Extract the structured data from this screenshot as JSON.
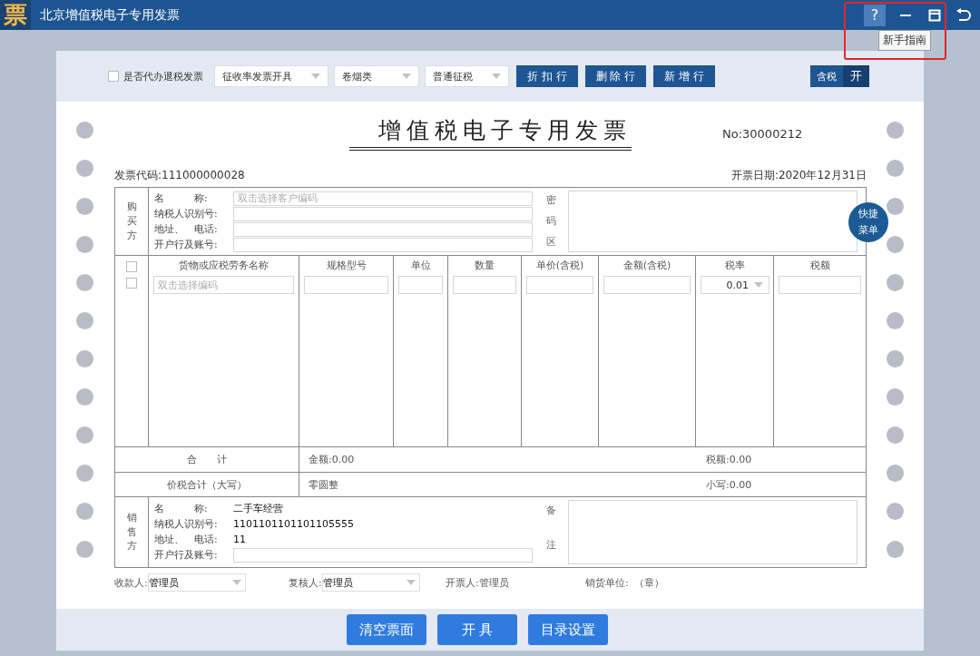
{
  "window": {
    "logo": "票",
    "title": "北京增值税电子专用发票",
    "help": "?",
    "tooltip": "新手指南"
  },
  "toolbar": {
    "checkbox": {
      "label": "是否代办退税发票",
      "checked": false
    },
    "dropdowns": [
      {
        "value": "征收率发票开具"
      },
      {
        "value": "卷烟类"
      },
      {
        "value": "普通征税"
      }
    ],
    "buttons": [
      "折 扣 行",
      "删 除 行",
      "新 增 行"
    ],
    "tax_toggle": {
      "label": "含税",
      "value": "开",
      "on": true
    }
  },
  "invoice": {
    "title": "增值税电子专用发票",
    "number": "No:30000212",
    "code": "发票代码:111000000028",
    "date": "开票日期:2020年12月31日",
    "buyer": {
      "side_label": "购买方",
      "fields": [
        {
          "label": "名　　　称:",
          "placeholder": "双击选择客户编码"
        },
        {
          "label": "纳税人识别号:"
        },
        {
          "label": "地址、　电话:"
        },
        {
          "label": "开户行及账号:"
        }
      ],
      "cipher_label": "密码区"
    },
    "quick_menu": "快捷菜单",
    "items": {
      "select_checkboxes": [
        {
          "checked": false
        },
        {
          "checked": false
        }
      ],
      "columns": [
        "货物或应税劳务名称",
        "规格型号",
        "单位",
        "数量",
        "单价(含税)",
        "金额(含税)",
        "税率",
        "税额"
      ],
      "name_placeholder": "双击选择编码",
      "tax_rate": "0.01"
    },
    "total": {
      "label": "合　　计",
      "amount": "金额:0.00",
      "tax": "税额:0.00"
    },
    "grand_total": {
      "label": "价税合计（大写）",
      "words": "零圆整",
      "figures": "小写:0.00"
    },
    "seller": {
      "side_label": "销售方",
      "fields": [
        {
          "label": "名　　　称:",
          "kind": "text",
          "value": "二手车经营"
        },
        {
          "label": "纳税人识别号:",
          "kind": "text",
          "value": "1101101101101105555"
        },
        {
          "label": "地址、　电话:",
          "kind": "text",
          "value": "11"
        },
        {
          "label": "开户行及账号:",
          "kind": "input"
        }
      ],
      "remarks_label": "备注"
    },
    "signatures": [
      {
        "kind": "dropdown",
        "label": "收款人:",
        "value": "管理员"
      },
      {
        "kind": "dropdown",
        "label": "复核人:",
        "value": "管理员"
      },
      {
        "kind": "text",
        "label": "开票人:",
        "value": "管理员"
      },
      {
        "kind": "text",
        "label": "销货单位:",
        "value": "（章）"
      }
    ]
  },
  "actions": [
    "清空票面",
    "开 具",
    "目录设置"
  ]
}
